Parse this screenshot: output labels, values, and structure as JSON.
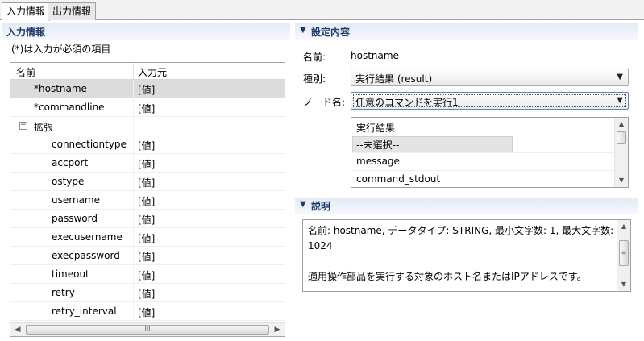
{
  "tabs": [
    {
      "label": "入力情報",
      "active": true
    },
    {
      "label": "出力情報",
      "active": false
    }
  ],
  "left": {
    "header": "入力情報",
    "note": "(*)は入力が必須の項目",
    "columns": [
      "名前",
      "入力元"
    ],
    "rows": [
      {
        "name": "*hostname",
        "value": "[値]",
        "selected": true
      },
      {
        "name": "*commandline",
        "value": "[値]"
      },
      {
        "name": "拡張",
        "value": "",
        "group": true,
        "toggle": "−"
      },
      {
        "name": "connectiontype",
        "value": "[値]"
      },
      {
        "name": "accport",
        "value": "[値]"
      },
      {
        "name": "ostype",
        "value": "[値]"
      },
      {
        "name": "username",
        "value": "[値]"
      },
      {
        "name": "password",
        "value": "[値]"
      },
      {
        "name": "execusername",
        "value": "[値]"
      },
      {
        "name": "execpassword",
        "value": "[値]"
      },
      {
        "name": "timeout",
        "value": "[値]"
      },
      {
        "name": "retry",
        "value": "[値]"
      },
      {
        "name": "retry_interval",
        "value": "[値]"
      }
    ],
    "hscroll": {
      "left_arrow": "◀",
      "right_arrow": "▶",
      "grip": "III"
    }
  },
  "settings": {
    "header": "設定内容",
    "header_icon": "▼",
    "name_label": "名前:",
    "name_value": "hostname",
    "kind_label": "種別:",
    "kind_value": "実行結果 (result)",
    "node_label": "ノード名:",
    "node_value": "任意のコマンドを実行1",
    "dropdown_arrow": "▼",
    "list_header": "実行結果",
    "list_items": [
      "--未選択--",
      "message",
      "command_stdout"
    ],
    "list_scroll": {
      "up": "▲",
      "down": "▼"
    }
  },
  "description": {
    "header": "説明",
    "header_icon": "▼",
    "line1": "名前: hostname, データタイプ: STRING, 最小文字数: 1, 最大文字数: 1024",
    "line2": "適用操作部品を実行する対象のホスト名またはIPアドレスです。",
    "scroll": {
      "up": "▲",
      "down": "▼",
      "grip": "≡"
    }
  }
}
